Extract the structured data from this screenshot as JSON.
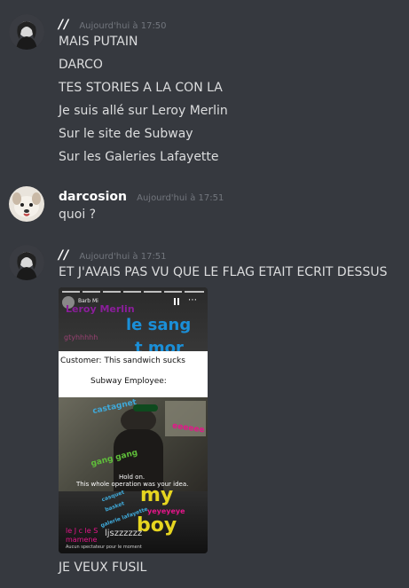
{
  "messages": [
    {
      "username": "//",
      "timestamp": "Aujourd'hui à 17:50",
      "lines": [
        "MAIS PUTAIN",
        "DARCO",
        "TES STORIES A LA CON LA",
        "Je suis allé sur Leroy Merlin",
        "Sur le site de Subway",
        "Sur les Galeries Lafayette"
      ]
    },
    {
      "username": "darcosion",
      "timestamp": "Aujourd'hui à 17:51",
      "lines": [
        "quoi ?"
      ]
    },
    {
      "username": "//",
      "timestamp": "Aujourd'hui à 17:51",
      "lines": [
        "ET J'AVAIS PAS VU QUE LE FLAG ETAIT ECRIT DESSUS"
      ],
      "after_image": "JE VEUX FUSIL"
    }
  ],
  "story": {
    "account": "Barb Mi",
    "leroy": "Leroy Merlin",
    "le_sang": "le sang",
    "t_mor": "t mor",
    "pink_blur": "gtyhhhhh",
    "customer": "Customer: This sandwich sucks",
    "employee": "Subway Employee:",
    "castagnet": "castagnet",
    "eeee": "eeeeee",
    "gang": "gang gang",
    "hold_on": "Hold on.",
    "operation": "This whole operation was your idea.",
    "my": "my",
    "boy": "boy",
    "casquet": "casquet",
    "basket": "basket",
    "galerie": "galerie lafayette",
    "yeyeyeye": "yeyeyeye",
    "jcle": "le J c le S",
    "mamene": "mamene",
    "zzz": "ljszzzzzz",
    "spectator": "Aucun spectateur pour le moment"
  }
}
